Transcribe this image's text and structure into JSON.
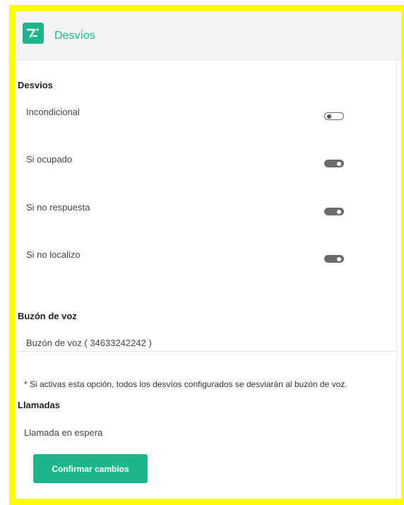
{
  "header": {
    "title": "Desvíos",
    "logo_icon": "forward-call-logo-icon"
  },
  "desvios": {
    "title": "Desvios",
    "items": [
      {
        "label": "Incondicional",
        "enabled": false
      },
      {
        "label": "Si ocupado",
        "enabled": true
      },
      {
        "label": "Si no respuesta",
        "enabled": true
      },
      {
        "label": "Si no localizo",
        "enabled": true
      }
    ]
  },
  "voicemail": {
    "title": "Buzón de voz",
    "label": "Buzón de voz ( 34633242242 )",
    "note": "* Si activas esta opción, todos los desvíos configurados se desviarán al buzón de voz."
  },
  "calls": {
    "title": "Llamadas",
    "label": "Llamada en espera"
  },
  "actions": {
    "confirm_label": "Confirmar cambios"
  },
  "colors": {
    "accent": "#1db58a",
    "frame": "#ffff00",
    "toggle_on": "#6b6b6b"
  }
}
